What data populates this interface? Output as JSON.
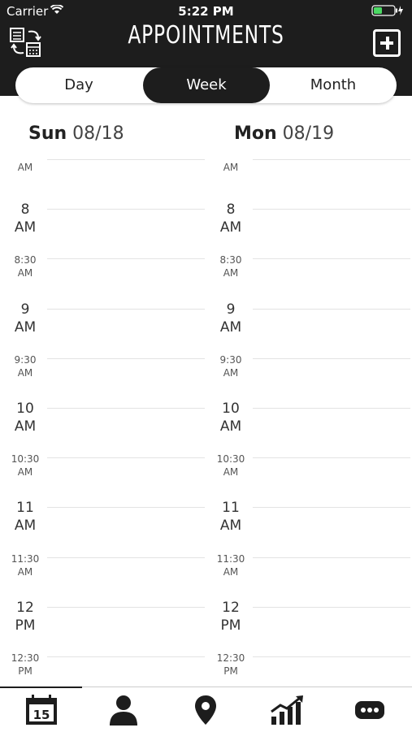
{
  "status": {
    "carrier": "Carrier",
    "time": "5:22 PM"
  },
  "header": {
    "title": "APPOINTMENTS"
  },
  "segments": {
    "day": "Day",
    "week": "Week",
    "month": "Month",
    "selected": "Week"
  },
  "days": [
    {
      "weekday": "Sun",
      "date": "08/18"
    },
    {
      "weekday": "Mon",
      "date": "08/19"
    }
  ],
  "slots": [
    {
      "l1": "",
      "l2": "AM",
      "size": "small"
    },
    {
      "l1": "8",
      "l2": "AM",
      "size": "big"
    },
    {
      "l1": "8:30",
      "l2": "AM",
      "size": "small"
    },
    {
      "l1": "9",
      "l2": "AM",
      "size": "big"
    },
    {
      "l1": "9:30",
      "l2": "AM",
      "size": "small"
    },
    {
      "l1": "10",
      "l2": "AM",
      "size": "big"
    },
    {
      "l1": "10:30",
      "l2": "AM",
      "size": "small"
    },
    {
      "l1": "11",
      "l2": "AM",
      "size": "big"
    },
    {
      "l1": "11:30",
      "l2": "AM",
      "size": "small"
    },
    {
      "l1": "12",
      "l2": "PM",
      "size": "big"
    },
    {
      "l1": "12:30",
      "l2": "PM",
      "size": "small"
    }
  ],
  "tabs": [
    {
      "name": "calendar-tab",
      "icon": "calendar-icon",
      "label": "15"
    },
    {
      "name": "clients-tab",
      "icon": "person-icon"
    },
    {
      "name": "location-tab",
      "icon": "map-pin-icon"
    },
    {
      "name": "stats-tab",
      "icon": "chart-icon"
    },
    {
      "name": "more-tab",
      "icon": "more-icon"
    }
  ]
}
